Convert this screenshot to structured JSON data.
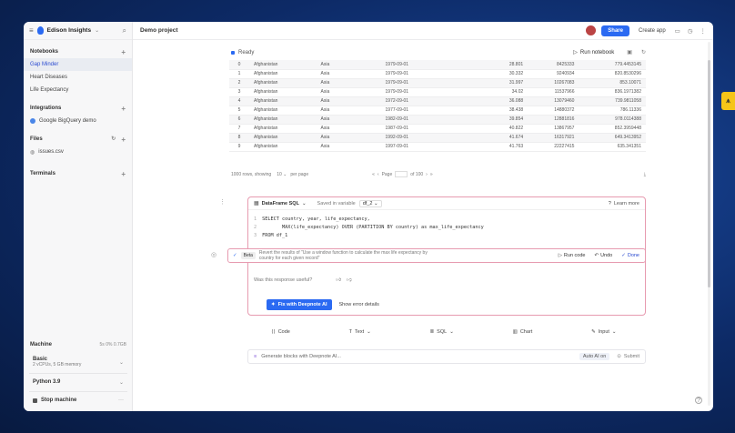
{
  "app": {
    "workspace": "Edison Insights",
    "project": "Demo project",
    "share_label": "Share",
    "create_app_label": "Create app"
  },
  "sidebar": {
    "notebooks_label": "Notebooks",
    "notebooks": [
      "Gap Minder",
      "Heart Diseases",
      "Life Expectancy"
    ],
    "integrations_label": "Integrations",
    "integrations": [
      "Google BigQuery demo"
    ],
    "files_label": "Files",
    "files": [
      "issues.csv"
    ],
    "terminals_label": "Terminals",
    "machine_label": "Machine",
    "machine_stats": "5s  0%  0.7GB",
    "machine_type": "Basic",
    "machine_specs": "2 vCPUs, 5 GB memory",
    "python_version": "Python 3.9",
    "stop_label": "Stop machine"
  },
  "notebook": {
    "status": "Ready",
    "run_notebook_label": "Run notebook",
    "table": {
      "rows": [
        [
          "0",
          "Afghanistan",
          "Asia",
          "1979-09-01",
          "28.801",
          "8425333",
          "779.4453145"
        ],
        [
          "1",
          "Afghanistan",
          "Asia",
          "1979-09-01",
          "30.332",
          "9240934",
          "820.8530296"
        ],
        [
          "2",
          "Afghanistan",
          "Asia",
          "1979-09-01",
          "31.997",
          "10267083",
          "853.10071"
        ],
        [
          "3",
          "Afghanistan",
          "Asia",
          "1979-09-01",
          "34.02",
          "11537966",
          "836.1971382"
        ],
        [
          "4",
          "Afghanistan",
          "Asia",
          "1972-09-01",
          "36.088",
          "13079460",
          "739.9811058"
        ],
        [
          "5",
          "Afghanistan",
          "Asia",
          "1977-09-01",
          "38.438",
          "14880372",
          "786.11336"
        ],
        [
          "6",
          "Afghanistan",
          "Asia",
          "1982-09-01",
          "39.854",
          "12881816",
          "978.0114388"
        ],
        [
          "7",
          "Afghanistan",
          "Asia",
          "1987-09-01",
          "40.822",
          "13867957",
          "852.3959448"
        ],
        [
          "8",
          "Afghanistan",
          "Asia",
          "1992-09-01",
          "41.674",
          "16317921",
          "649.3413952"
        ],
        [
          "9",
          "Afghanistan",
          "Asia",
          "1997-09-01",
          "41.763",
          "22227415",
          "635.341351"
        ]
      ],
      "rows_summary": "1000 rows, showing",
      "per_page": "10",
      "per_page_label": "per page",
      "page_label": "Page",
      "page_total": "of 100"
    },
    "sql_block": {
      "source": "DataFrame SQL",
      "saved_label": "Saved in variable",
      "variable": "df_2",
      "learn_more": "Learn more",
      "line1": "SELECT country, year, life_expectancy,",
      "line2": "       MAX(life_expectancy) OVER (PARTITION BY country) as max_life_expectancy",
      "line3": "FROM df_1"
    },
    "ai": {
      "beta": "Beta",
      "prompt": "Revert the results of \"Use a window function to calculate the max life expectancy by country for each given record\"",
      "run_code": "Run code",
      "undo": "Undo",
      "done": "Done",
      "feedback_question": "Was this response useful?",
      "fix_label": "Fix with Deepnote AI",
      "show_errors": "Show error details"
    },
    "toolbar": [
      "Code",
      "Text",
      "SQL",
      "Chart",
      "Input"
    ],
    "generate_placeholder": "Generate blocks with Deepnote AI...",
    "auto_ai": "Auto AI on",
    "submit": "Submit"
  },
  "colors": {
    "accent": "#2b6af2",
    "border_highlight": "#e79bb0",
    "sidebar_active": "#2b4bd0"
  }
}
